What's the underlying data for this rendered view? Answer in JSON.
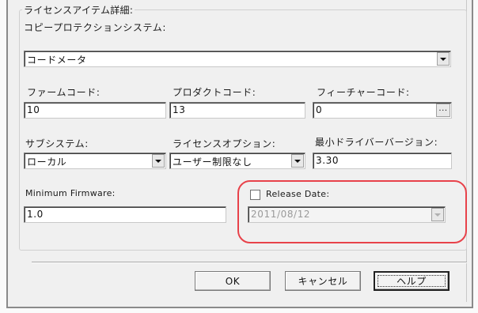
{
  "group": {
    "title": "ライセンスアイテム詳細:"
  },
  "copy_protection": {
    "label": "コピープロテクションシステム:",
    "value": "コードメータ"
  },
  "firm_code": {
    "label": "ファームコード:",
    "value": "10"
  },
  "product_code": {
    "label": "プロダクトコード:",
    "value": "13"
  },
  "feature_code": {
    "label": "フィーチャーコード:",
    "value": "0",
    "browse_label": "..."
  },
  "subsystem": {
    "label": "サブシステム:",
    "value": "ローカル"
  },
  "license_option": {
    "label": "ライセンスオプション:",
    "value": "ユーザー制限なし"
  },
  "min_driver_version": {
    "label": "最小ドライバーバージョン:",
    "value": "3.30"
  },
  "min_firmware": {
    "label": "Minimum Firmware:",
    "value": "1.0"
  },
  "release_date": {
    "label": "Release Date:",
    "checked": false,
    "value": "2011/08/12"
  },
  "buttons": {
    "ok": "OK",
    "cancel": "キャンセル",
    "help": "ヘルプ"
  },
  "colors": {
    "highlight": "#e8424a",
    "dialog_bg": "#f0f0f0",
    "disabled_text": "#9a9a9a"
  }
}
